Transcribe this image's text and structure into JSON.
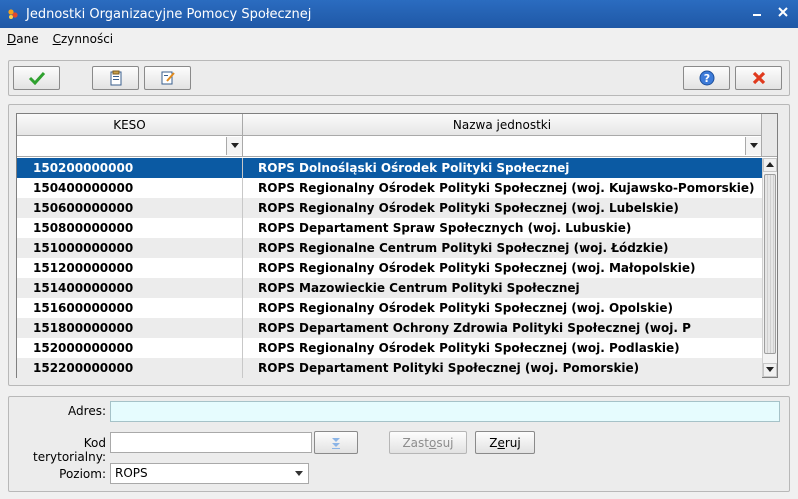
{
  "window": {
    "title": "Jednostki Organizacyjne Pomocy Społecznej"
  },
  "menu": [
    {
      "label_first": "D",
      "label_rest": "ane"
    },
    {
      "label_first": "C",
      "label_rest": "zynności"
    }
  ],
  "toolbar": {
    "accept_icon": "check-icon",
    "copy_icon": "clipboard-icon",
    "edit_icon": "edit-note-icon",
    "help_icon": "help-icon",
    "cancel_icon": "red-x-icon"
  },
  "grid": {
    "columns": [
      "KESO",
      "Nazwa jednostki"
    ],
    "rows": [
      {
        "keso": "150200000000",
        "name": "ROPS Dolnośląski Ośrodek Polityki Społecznej"
      },
      {
        "keso": "150400000000",
        "name": "ROPS Regionalny Ośrodek Polityki Społecznej (woj. Kujawsko-Pomorskie)"
      },
      {
        "keso": "150600000000",
        "name": "ROPS Regionalny Ośrodek Polityki Społecznej (woj. Lubelskie)"
      },
      {
        "keso": "150800000000",
        "name": "ROPS Departament Spraw Społecznych (woj. Lubuskie)"
      },
      {
        "keso": "151000000000",
        "name": "ROPS Regionalne Centrum Polityki Społecznej (woj. Łódzkie)"
      },
      {
        "keso": "151200000000",
        "name": "ROPS Regionalny Ośrodek Polityki Społecznej (woj. Małopolskie)"
      },
      {
        "keso": "151400000000",
        "name": "ROPS Mazowieckie Centrum Polityki Społecznej"
      },
      {
        "keso": "151600000000",
        "name": "ROPS Regionalny Ośrodek Polityki Społecznej (woj. Opolskie)"
      },
      {
        "keso": "151800000000",
        "name": "ROPS Departament Ochrony Zdrowia Polityki Społecznej (woj. P"
      },
      {
        "keso": "152000000000",
        "name": "ROPS Regionalny Ośrodek Polityki Społecznej (woj. Podlaskie)"
      },
      {
        "keso": "152200000000",
        "name": "ROPS Departament Polityki Społecznej (woj. Pomorskie)"
      }
    ]
  },
  "form": {
    "adres_label": "Adres:",
    "adres_value": "",
    "kod_label": "Kod terytorialny:",
    "kod_value": "",
    "zastosuj_label_pre": "Zast",
    "zastosuj_label_u": "o",
    "zastosuj_label_post": "suj",
    "zeruj_label_pre": "Z",
    "zeruj_label_u": "e",
    "zeruj_label_post": "ruj",
    "poziom_label": "Poziom:",
    "poziom_value": "ROPS"
  },
  "colors": {
    "titlebar": "#1f58a6",
    "selection": "#0b5aa3",
    "address_bg": "#e6fcfe"
  }
}
